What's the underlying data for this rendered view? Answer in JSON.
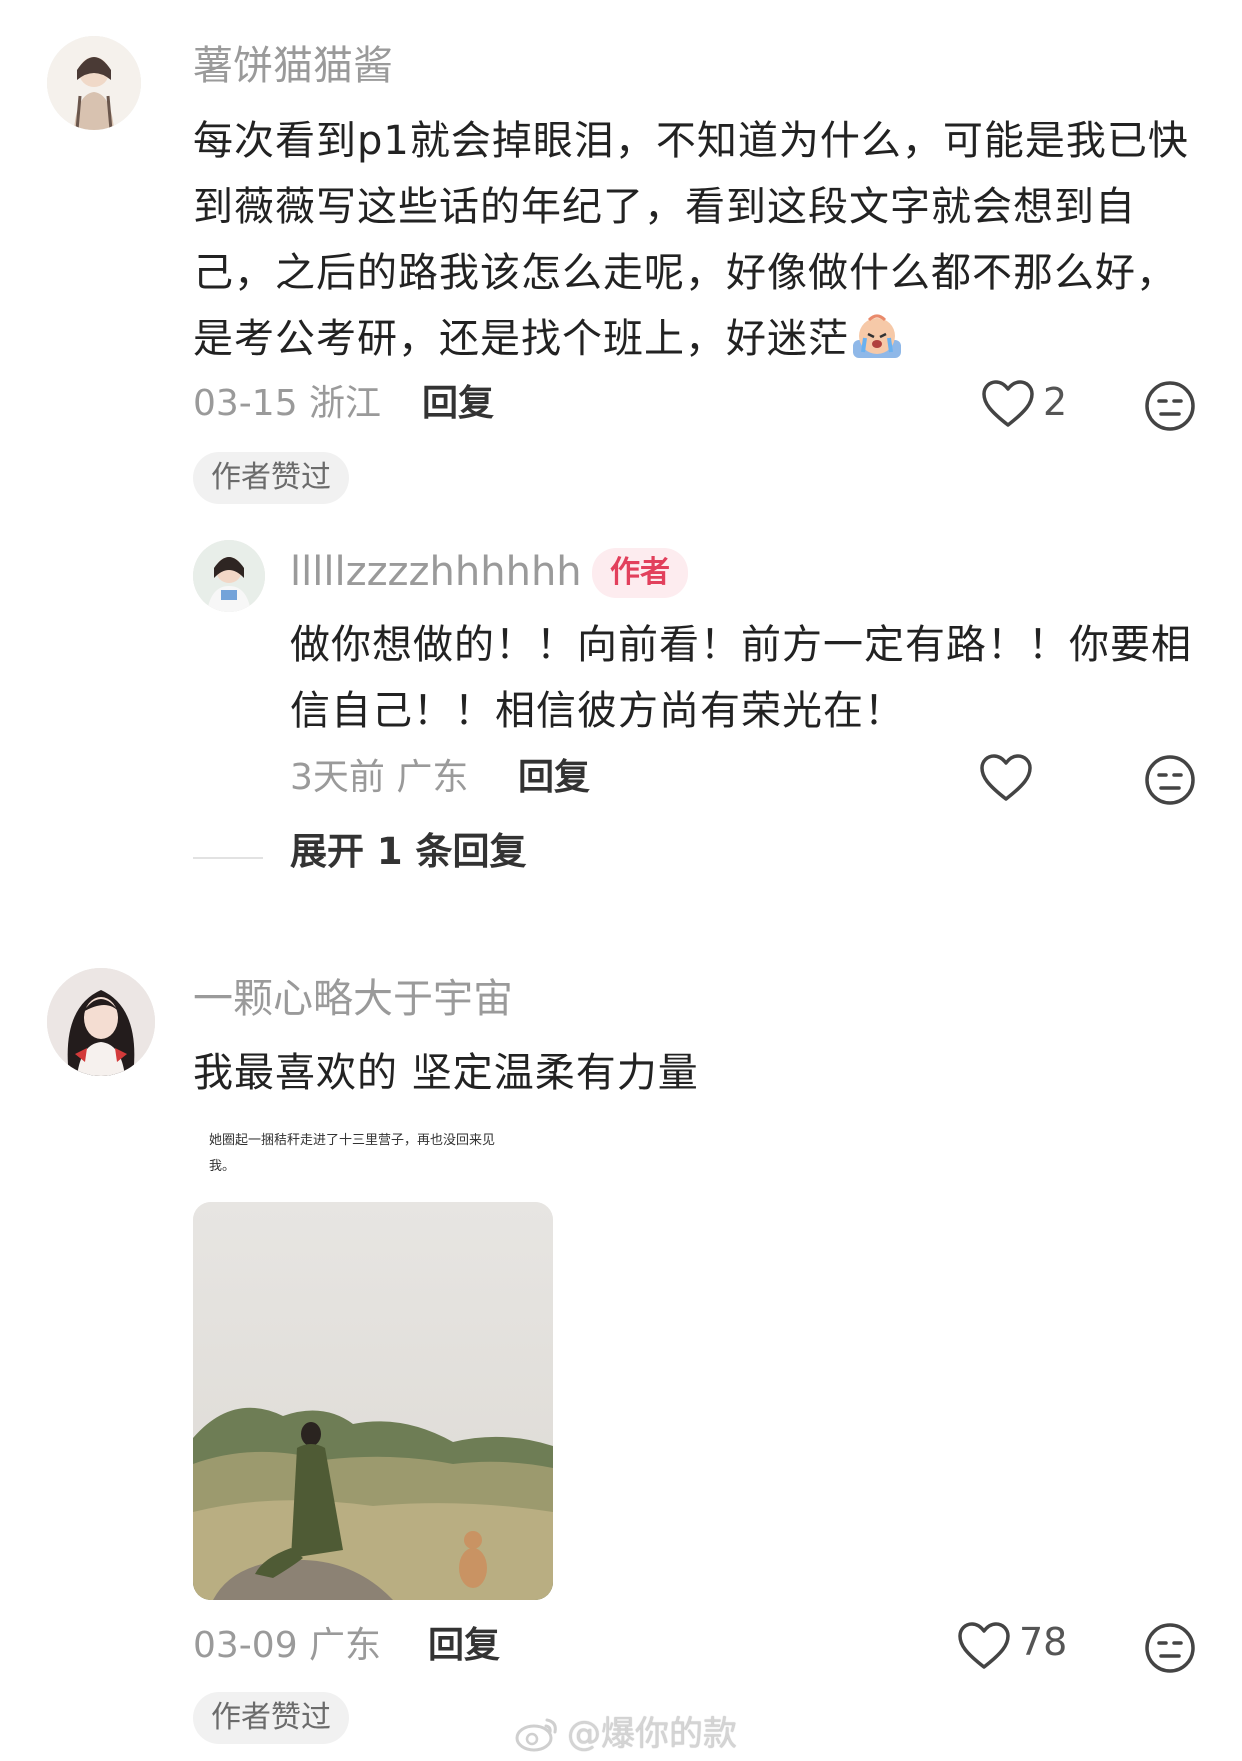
{
  "comments": [
    {
      "username": "薯饼猫猫酱",
      "content": "每次看到p1就会掉眼泪，不知道为什么，可能是我已快到薇薇写这些话的年纪了，看到这段文字就会想到自己，之后的路我该怎么走呢，好像做什么都不那么好，是考公考研，还是找个班上，好迷茫",
      "emoji_icon": "crying-face-emoji",
      "date_location": "03-15 浙江",
      "reply_label": "回复",
      "like_count": "2",
      "author_liked_label": "作者赞过",
      "reply": {
        "username": "lllllzzzzhhhhhh",
        "author_badge": "作者",
        "content": "做你想做的！！向前看！前方一定有路！！你要相信自己！！相信彼方尚有荣光在！",
        "date_location": "3天前 广东",
        "reply_label": "回复"
      },
      "expand_label": "展开 1 条回复"
    },
    {
      "username": "一颗心略大于宇宙",
      "content": "我最喜欢的 坚定温柔有力量",
      "image_quote": "她圈起一捆秸秆走进了十三里营子，再也没回来见我。",
      "date_location": "03-09 广东",
      "reply_label": "回复",
      "like_count": "78",
      "author_liked_label": "作者赞过"
    }
  ],
  "watermark": "@爆你的款",
  "colors": {
    "username": "#9a9a9a",
    "text": "#222222",
    "author_badge_bg": "#fdecef",
    "author_badge_text": "#e2405c",
    "pill_bg": "#f1f1f1"
  }
}
